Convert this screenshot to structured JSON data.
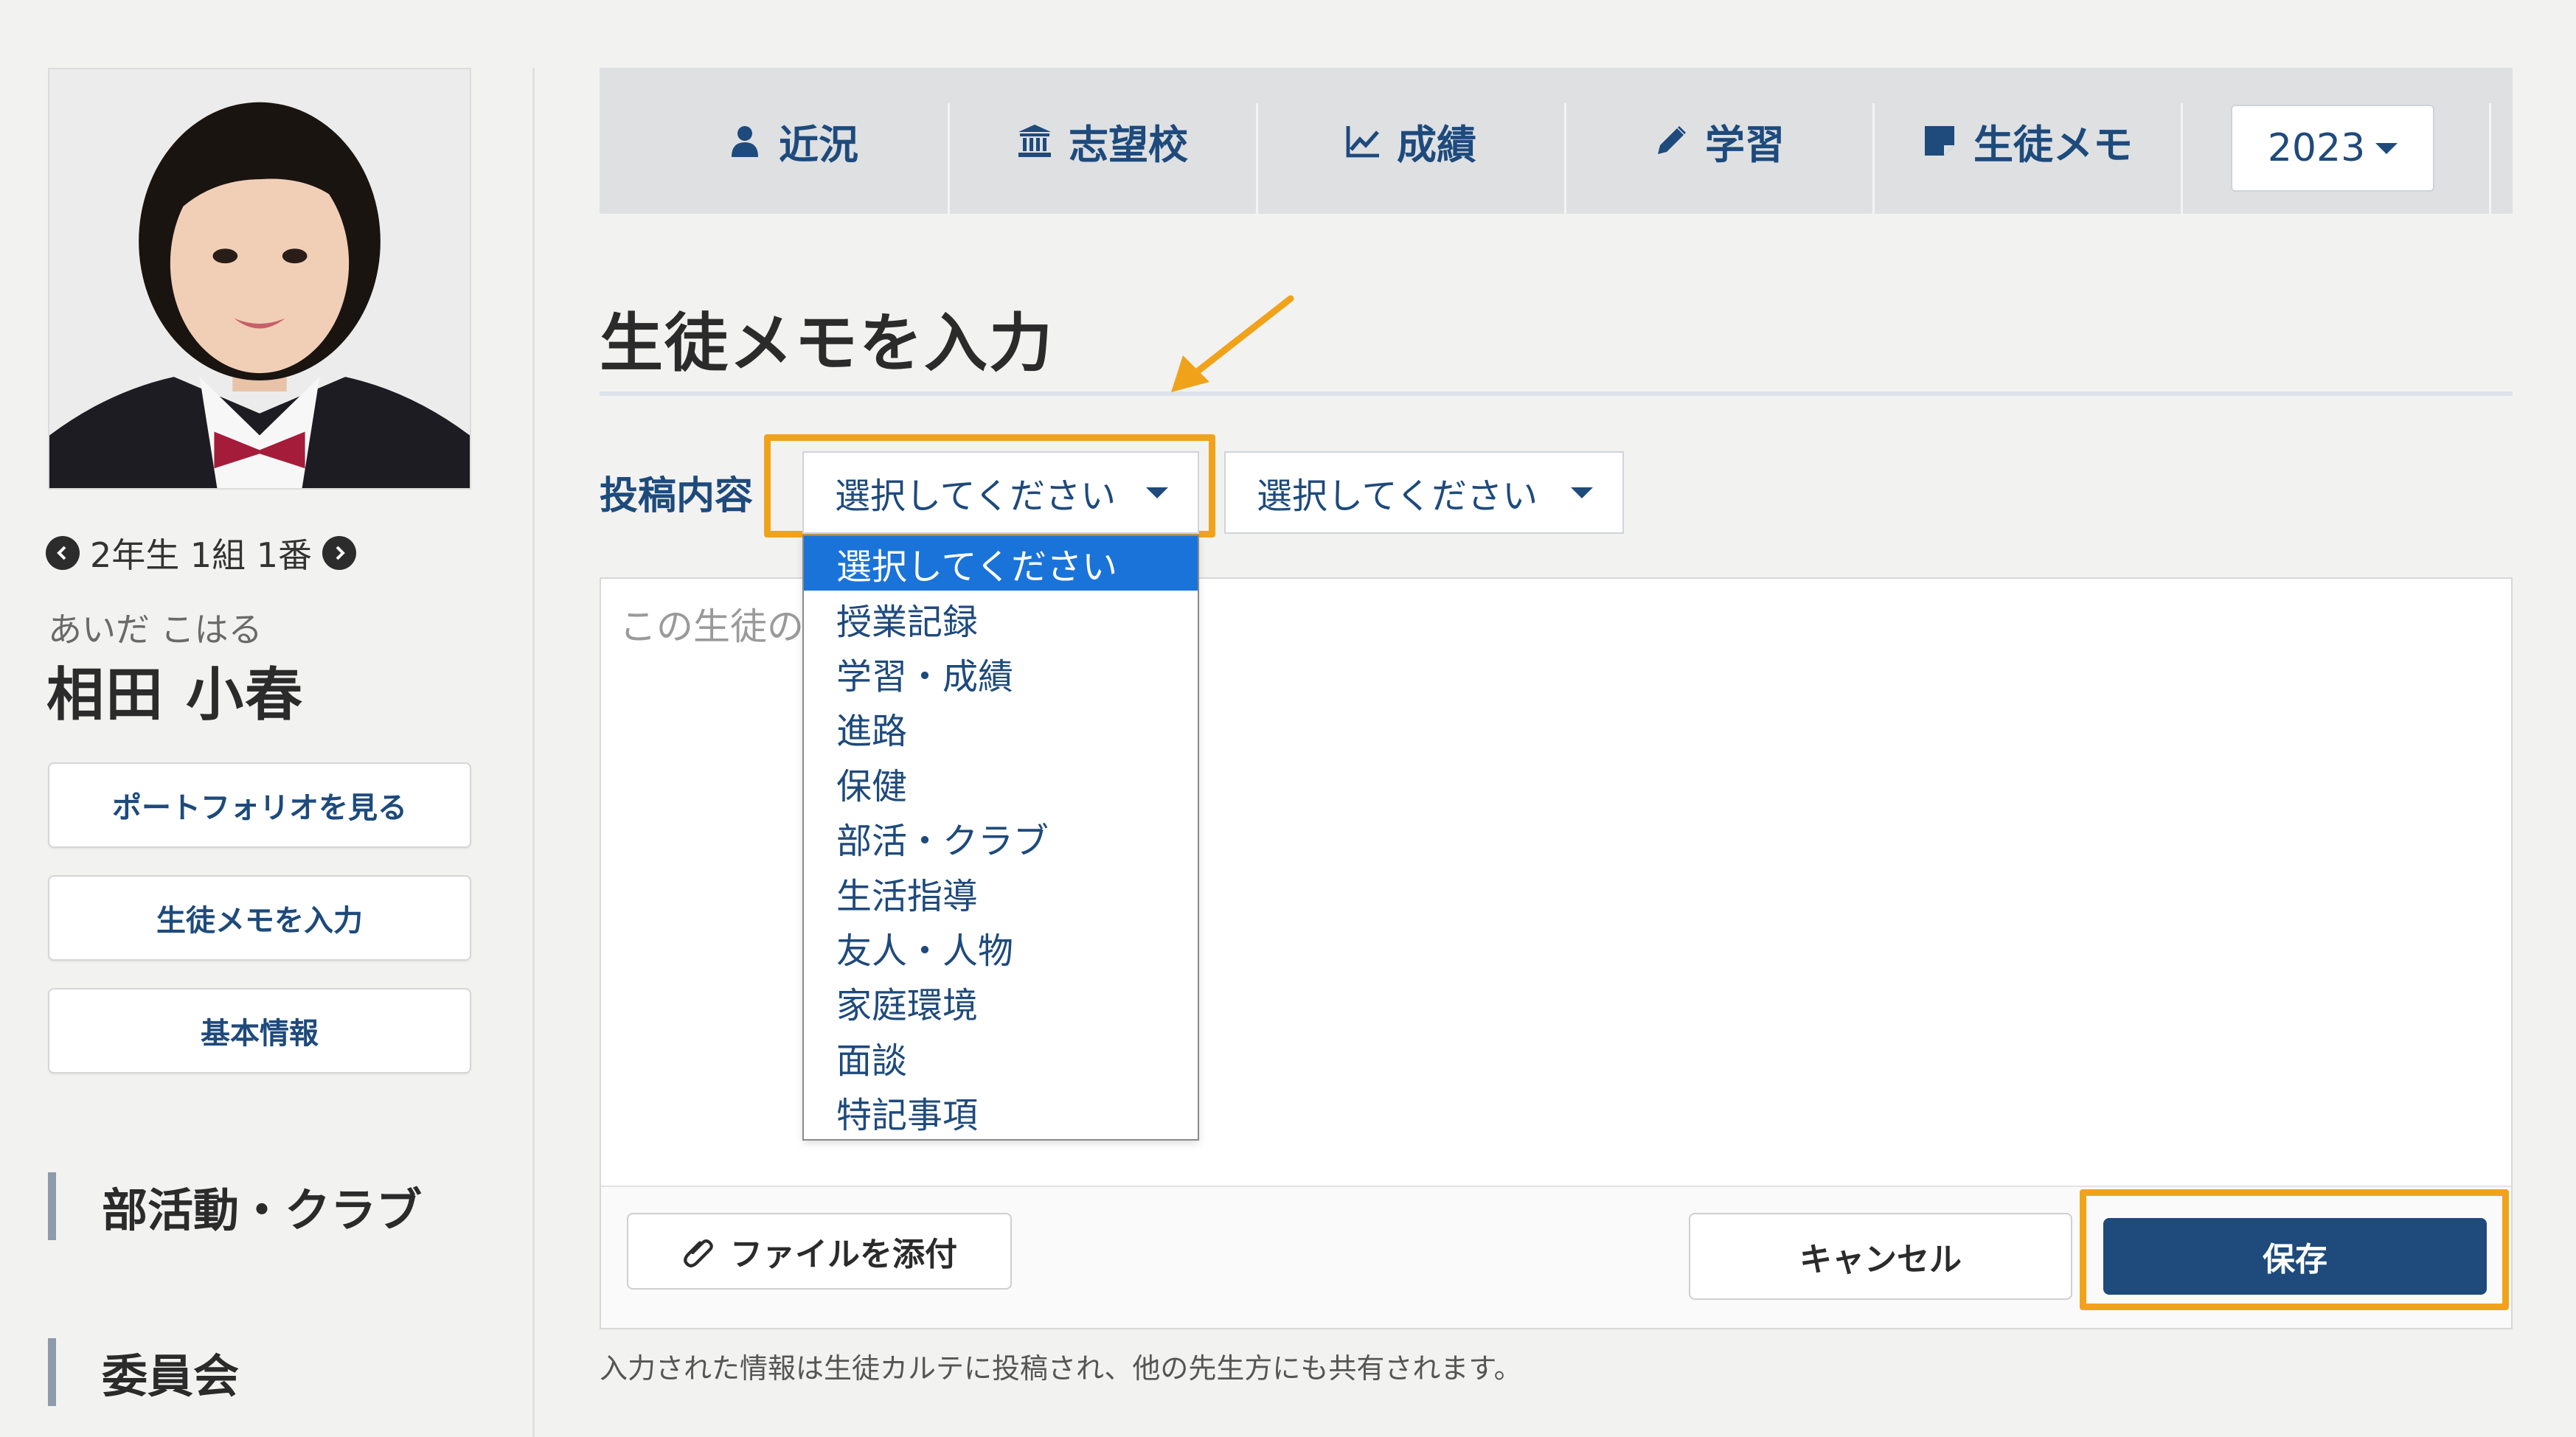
{
  "student": {
    "nav_text": "2年生 1組 1番",
    "kana": "あいだ こはる",
    "name": "相田 小春"
  },
  "sidebar": {
    "buttons": [
      {
        "label": "ポートフォリオを見る"
      },
      {
        "label": "生徒メモを入力"
      },
      {
        "label": "基本情報"
      }
    ],
    "sections": [
      {
        "label": "部活動・クラブ"
      },
      {
        "label": "委員会"
      }
    ]
  },
  "tabs": [
    {
      "label": "近況",
      "icon": "person-icon"
    },
    {
      "label": "志望校",
      "icon": "school-building-icon"
    },
    {
      "label": "成績",
      "icon": "line-chart-icon"
    },
    {
      "label": "学習",
      "icon": "pencil-icon"
    },
    {
      "label": "生徒メモ",
      "icon": "note-icon"
    }
  ],
  "year_select": {
    "value": "2023"
  },
  "page": {
    "title": "生徒メモを入力",
    "post_label": "投稿内容",
    "select1": {
      "value": "選択してください"
    },
    "select2": {
      "value": "選択してください"
    },
    "textarea_placeholder": "この生徒の",
    "dropdown_options": [
      "選択してください",
      "授業記録",
      "学習・成績",
      "進路",
      "保健",
      "部活・クラブ",
      "生活指導",
      "友人・人物",
      "家庭環境",
      "面談",
      "特記事項"
    ],
    "attach_label": "ファイルを添付",
    "cancel_label": "キャンセル",
    "save_label": "保存",
    "footnote": "入力された情報は生徒カルテに投稿され、他の先生方にも共有されます。"
  },
  "colors": {
    "accent": "#1e4a7c",
    "highlight": "#f0a31a",
    "selected_option": "#1a73d8",
    "background": "#f2f2f1"
  }
}
